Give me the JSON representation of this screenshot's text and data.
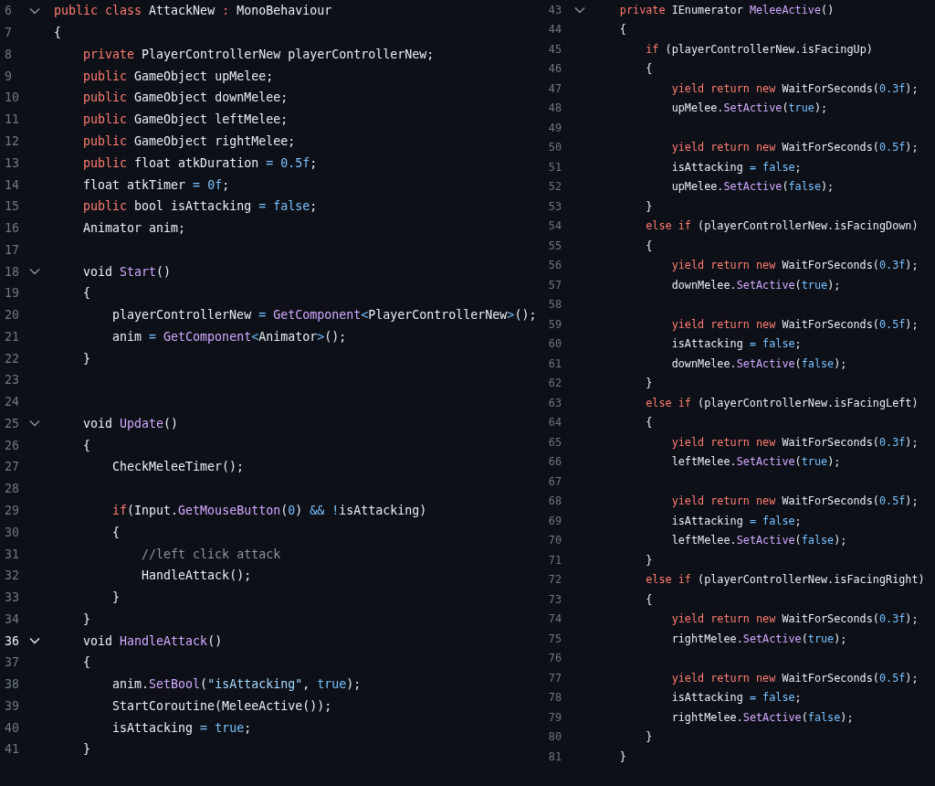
{
  "panes": [
    {
      "lines": [
        {
          "number": "6",
          "fold": true,
          "current": false,
          "tokens": [
            {
              "kind": "keyword",
              "text": "public class"
            },
            {
              "kind": "plain",
              "text": " AttackNew "
            },
            {
              "kind": "keyword",
              "text": ":"
            },
            {
              "kind": "plain",
              "text": " MonoBehaviour"
            }
          ]
        },
        {
          "number": "7",
          "fold": false,
          "current": false,
          "tokens": [
            {
              "kind": "plain",
              "text": "{"
            }
          ],
          "children": [
            {
              "number": "8",
              "fold": false,
              "current": false,
              "tokens": [
                {
                  "kind": "keyword",
                  "text": "private"
                },
                {
                  "kind": "plain",
                  "text": " PlayerControllerNew playerControllerNew;"
                }
              ]
            },
            {
              "number": "9",
              "fold": false,
              "current": false,
              "tokens": [
                {
                  "kind": "keyword",
                  "text": "public"
                },
                {
                  "kind": "plain",
                  "text": " GameObject upMelee;"
                }
              ]
            },
            {
              "number": "10",
              "fold": false,
              "current": false,
              "tokens": [
                {
                  "kind": "keyword",
                  "text": "public"
                },
                {
                  "kind": "plain",
                  "text": " GameObject downMelee;"
                }
              ]
            },
            {
              "number": "11",
              "fold": false,
              "current": false,
              "tokens": [
                {
                  "kind": "keyword",
                  "text": "public"
                },
                {
                  "kind": "plain",
                  "text": " GameObject leftMelee;"
                }
              ]
            },
            {
              "number": "12",
              "fold": false,
              "current": false,
              "tokens": [
                {
                  "kind": "keyword",
                  "text": "public"
                },
                {
                  "kind": "plain",
                  "text": " GameObject rightMelee;"
                }
              ]
            },
            {
              "number": "13",
              "fold": false,
              "current": false,
              "tokens": [
                {
                  "kind": "keyword",
                  "text": "public"
                },
                {
                  "kind": "plain",
                  "text": " float atkDuration "
                },
                {
                  "kind": "operator",
                  "text": "= "
                },
                {
                  "kind": "literal",
                  "text": "0.5f"
                },
                {
                  "kind": "plain",
                  "text": ";"
                }
              ]
            },
            {
              "number": "14",
              "fold": false,
              "current": false,
              "tokens": [
                {
                  "kind": "plain",
                  "text": "float atkTimer "
                },
                {
                  "kind": "operator",
                  "text": "= "
                },
                {
                  "kind": "literal",
                  "text": "0f"
                },
                {
                  "kind": "plain",
                  "text": ";"
                }
              ]
            },
            {
              "number": "15",
              "fold": false,
              "current": false,
              "tokens": [
                {
                  "kind": "keyword",
                  "text": "public"
                },
                {
                  "kind": "plain",
                  "text": " bool isAttacking "
                },
                {
                  "kind": "operator",
                  "text": "= "
                },
                {
                  "kind": "literal",
                  "text": "false"
                },
                {
                  "kind": "plain",
                  "text": ";"
                }
              ]
            },
            {
              "number": "16",
              "fold": false,
              "current": false,
              "tokens": [
                {
                  "kind": "plain",
                  "text": "Animator anim;"
                }
              ]
            },
            {
              "number": "17",
              "fold": false,
              "current": false
            },
            {
              "number": "18",
              "fold": true,
              "current": false,
              "tokens": [
                {
                  "kind": "plain",
                  "text": "void "
                },
                {
                  "kind": "function",
                  "text": "Start"
                },
                {
                  "kind": "plain",
                  "text": "()"
                }
              ]
            },
            {
              "number": "19",
              "fold": false,
              "current": false,
              "tokens": [
                {
                  "kind": "plain",
                  "text": "{"
                }
              ],
              "children": [
                {
                  "number": "20",
                  "fold": false,
                  "current": false,
                  "tokens": [
                    {
                      "kind": "plain",
                      "text": "playerControllerNew "
                    },
                    {
                      "kind": "operator",
                      "text": "= "
                    },
                    {
                      "kind": "function",
                      "text": "GetComponent"
                    },
                    {
                      "kind": "operator",
                      "text": "<"
                    },
                    {
                      "kind": "plain",
                      "text": "PlayerControllerNew"
                    },
                    {
                      "kind": "operator",
                      "text": ">"
                    },
                    {
                      "kind": "plain",
                      "text": "();"
                    }
                  ]
                },
                {
                  "number": "21",
                  "fold": false,
                  "current": false,
                  "tokens": [
                    {
                      "kind": "plain",
                      "text": "anim "
                    },
                    {
                      "kind": "operator",
                      "text": "= "
                    },
                    {
                      "kind": "function",
                      "text": "GetComponent"
                    },
                    {
                      "kind": "operator",
                      "text": "<"
                    },
                    {
                      "kind": "plain",
                      "text": "Animator"
                    },
                    {
                      "kind": "operator",
                      "text": ">"
                    },
                    {
                      "kind": "plain",
                      "text": "();"
                    }
                  ]
                }
              ]
            },
            {
              "number": "22",
              "fold": false,
              "current": false,
              "tokens": [
                {
                  "kind": "plain",
                  "text": "}"
                }
              ]
            },
            {
              "number": "23",
              "fold": false,
              "current": false
            },
            {
              "number": "24",
              "fold": false,
              "current": false
            },
            {
              "number": "25",
              "fold": true,
              "current": false,
              "tokens": [
                {
                  "kind": "plain",
                  "text": "void "
                },
                {
                  "kind": "function",
                  "text": "Update"
                },
                {
                  "kind": "plain",
                  "text": "()"
                }
              ]
            },
            {
              "number": "26",
              "fold": false,
              "current": false,
              "tokens": [
                {
                  "kind": "plain",
                  "text": "{"
                }
              ],
              "children": [
                {
                  "number": "27",
                  "fold": false,
                  "current": false,
                  "tokens": [
                    {
                      "kind": "plain",
                      "text": "CheckMeleeTimer();"
                    }
                  ]
                },
                {
                  "number": "28",
                  "fold": false,
                  "current": false
                },
                {
                  "number": "29",
                  "fold": false,
                  "current": false,
                  "tokens": [
                    {
                      "kind": "keyword",
                      "text": "if"
                    },
                    {
                      "kind": "plain",
                      "text": "(Input."
                    },
                    {
                      "kind": "function",
                      "text": "GetMouseButton"
                    },
                    {
                      "kind": "plain",
                      "text": "("
                    },
                    {
                      "kind": "literal",
                      "text": "0"
                    },
                    {
                      "kind": "plain",
                      "text": ") "
                    },
                    {
                      "kind": "operator",
                      "text": "&& !"
                    },
                    {
                      "kind": "plain",
                      "text": "isAttacking)"
                    }
                  ]
                },
                {
                  "number": "30",
                  "fold": false,
                  "current": false,
                  "tokens": [
                    {
                      "kind": "plain",
                      "text": "{"
                    }
                  ],
                  "children": [
                    {
                      "number": "31",
                      "fold": false,
                      "current": false,
                      "tokens": [
                        {
                          "kind": "comment",
                          "text": "//left click attack"
                        }
                      ]
                    },
                    {
                      "number": "32",
                      "fold": false,
                      "current": false,
                      "tokens": [
                        {
                          "kind": "plain",
                          "text": "HandleAttack();"
                        }
                      ]
                    }
                  ]
                },
                {
                  "number": "33",
                  "fold": false,
                  "current": false,
                  "tokens": [
                    {
                      "kind": "plain",
                      "text": "}"
                    }
                  ]
                }
              ]
            },
            {
              "number": "34",
              "fold": false,
              "current": false,
              "tokens": [
                {
                  "kind": "plain",
                  "text": "}"
                }
              ]
            },
            {
              "number": "36",
              "fold": true,
              "current": true,
              "tokens": [
                {
                  "kind": "plain",
                  "text": "void "
                },
                {
                  "kind": "function",
                  "text": "HandleAttack"
                },
                {
                  "kind": "plain",
                  "text": "()"
                }
              ]
            },
            {
              "number": "37",
              "fold": false,
              "current": false,
              "tokens": [
                {
                  "kind": "plain",
                  "text": "{"
                }
              ],
              "children": [
                {
                  "number": "38",
                  "fold": false,
                  "current": false,
                  "tokens": [
                    {
                      "kind": "plain",
                      "text": "anim."
                    },
                    {
                      "kind": "function",
                      "text": "SetBool"
                    },
                    {
                      "kind": "plain",
                      "text": "("
                    },
                    {
                      "kind": "string",
                      "text": "\"isAttacking\""
                    },
                    {
                      "kind": "plain",
                      "text": ", "
                    },
                    {
                      "kind": "literal",
                      "text": "true"
                    },
                    {
                      "kind": "plain",
                      "text": ");"
                    }
                  ]
                },
                {
                  "number": "39",
                  "fold": false,
                  "current": false,
                  "tokens": [
                    {
                      "kind": "plain",
                      "text": "StartCoroutine(MeleeActive());"
                    }
                  ]
                },
                {
                  "number": "40",
                  "fold": false,
                  "current": false,
                  "tokens": [
                    {
                      "kind": "plain",
                      "text": "isAttacking "
                    },
                    {
                      "kind": "operator",
                      "text": "= "
                    },
                    {
                      "kind": "literal",
                      "text": "true"
                    },
                    {
                      "kind": "plain",
                      "text": ";"
                    }
                  ]
                }
              ]
            },
            {
              "number": "41",
              "fold": false,
              "current": false,
              "tokens": [
                {
                  "kind": "plain",
                  "text": "}"
                }
              ]
            }
          ]
        }
      ]
    },
    {
      "lines": [
        {
          "number": "43",
          "fold": true,
          "current": false,
          "tokens": [
            {
              "kind": "keyword",
              "text": "private"
            },
            {
              "kind": "plain",
              "text": " IEnumerator "
            },
            {
              "kind": "function",
              "text": "MeleeActive"
            },
            {
              "kind": "plain",
              "text": "()"
            }
          ]
        },
        {
          "number": "44",
          "fold": false,
          "current": false,
          "tokens": [
            {
              "kind": "plain",
              "text": "{"
            }
          ],
          "children": [
            {
              "number": "45",
              "fold": false,
              "current": false,
              "tokens": [
                {
                  "kind": "keyword",
                  "text": "if"
                },
                {
                  "kind": "plain",
                  "text": " (playerControllerNew.isFacingUp)"
                }
              ]
            },
            {
              "number": "46",
              "fold": false,
              "current": false,
              "tokens": [
                {
                  "kind": "plain",
                  "text": "{"
                }
              ],
              "children": [
                {
                  "number": "47",
                  "fold": false,
                  "current": false,
                  "tokens": [
                    {
                      "kind": "keyword",
                      "text": "yield return new"
                    },
                    {
                      "kind": "plain",
                      "text": " WaitForSeconds("
                    },
                    {
                      "kind": "literal",
                      "text": "0.3f"
                    },
                    {
                      "kind": "plain",
                      "text": ");"
                    }
                  ]
                },
                {
                  "number": "48",
                  "fold": false,
                  "current": false,
                  "tokens": [
                    {
                      "kind": "plain",
                      "text": "upMelee."
                    },
                    {
                      "kind": "function",
                      "text": "SetActive"
                    },
                    {
                      "kind": "plain",
                      "text": "("
                    },
                    {
                      "kind": "literal",
                      "text": "true"
                    },
                    {
                      "kind": "plain",
                      "text": ");"
                    }
                  ]
                },
                {
                  "number": "49",
                  "fold": false,
                  "current": false
                },
                {
                  "number": "50",
                  "fold": false,
                  "current": false,
                  "tokens": [
                    {
                      "kind": "keyword",
                      "text": "yield return new"
                    },
                    {
                      "kind": "plain",
                      "text": " WaitForSeconds("
                    },
                    {
                      "kind": "literal",
                      "text": "0.5f"
                    },
                    {
                      "kind": "plain",
                      "text": ");"
                    }
                  ]
                },
                {
                  "number": "51",
                  "fold": false,
                  "current": false,
                  "tokens": [
                    {
                      "kind": "plain",
                      "text": "isAttacking "
                    },
                    {
                      "kind": "operator",
                      "text": "= "
                    },
                    {
                      "kind": "literal",
                      "text": "false"
                    },
                    {
                      "kind": "plain",
                      "text": ";"
                    }
                  ]
                },
                {
                  "number": "52",
                  "fold": false,
                  "current": false,
                  "tokens": [
                    {
                      "kind": "plain",
                      "text": "upMelee."
                    },
                    {
                      "kind": "function",
                      "text": "SetActive"
                    },
                    {
                      "kind": "plain",
                      "text": "("
                    },
                    {
                      "kind": "literal",
                      "text": "false"
                    },
                    {
                      "kind": "plain",
                      "text": ");"
                    }
                  ]
                }
              ]
            },
            {
              "number": "53",
              "fold": false,
              "current": false,
              "tokens": [
                {
                  "kind": "plain",
                  "text": "}"
                }
              ]
            },
            {
              "number": "54",
              "fold": false,
              "current": false,
              "tokens": [
                {
                  "kind": "keyword",
                  "text": "else if"
                },
                {
                  "kind": "plain",
                  "text": " (playerControllerNew.isFacingDown)"
                }
              ]
            },
            {
              "number": "55",
              "fold": false,
              "current": false,
              "tokens": [
                {
                  "kind": "plain",
                  "text": "{"
                }
              ],
              "children": [
                {
                  "number": "56",
                  "fold": false,
                  "current": false,
                  "tokens": [
                    {
                      "kind": "keyword",
                      "text": "yield return new"
                    },
                    {
                      "kind": "plain",
                      "text": " WaitForSeconds("
                    },
                    {
                      "kind": "literal",
                      "text": "0.3f"
                    },
                    {
                      "kind": "plain",
                      "text": ");"
                    }
                  ]
                },
                {
                  "number": "57",
                  "fold": false,
                  "current": false,
                  "tokens": [
                    {
                      "kind": "plain",
                      "text": "downMelee."
                    },
                    {
                      "kind": "function",
                      "text": "SetActive"
                    },
                    {
                      "kind": "plain",
                      "text": "("
                    },
                    {
                      "kind": "literal",
                      "text": "true"
                    },
                    {
                      "kind": "plain",
                      "text": ");"
                    }
                  ]
                },
                {
                  "number": "58",
                  "fold": false,
                  "current": false
                },
                {
                  "number": "59",
                  "fold": false,
                  "current": false,
                  "tokens": [
                    {
                      "kind": "keyword",
                      "text": "yield return new"
                    },
                    {
                      "kind": "plain",
                      "text": " WaitForSeconds("
                    },
                    {
                      "kind": "literal",
                      "text": "0.5f"
                    },
                    {
                      "kind": "plain",
                      "text": ");"
                    }
                  ]
                },
                {
                  "number": "60",
                  "fold": false,
                  "current": false,
                  "tokens": [
                    {
                      "kind": "plain",
                      "text": "isAttacking "
                    },
                    {
                      "kind": "operator",
                      "text": "= "
                    },
                    {
                      "kind": "literal",
                      "text": "false"
                    },
                    {
                      "kind": "plain",
                      "text": ";"
                    }
                  ]
                },
                {
                  "number": "61",
                  "fold": false,
                  "current": false,
                  "tokens": [
                    {
                      "kind": "plain",
                      "text": "downMelee."
                    },
                    {
                      "kind": "function",
                      "text": "SetActive"
                    },
                    {
                      "kind": "plain",
                      "text": "("
                    },
                    {
                      "kind": "literal",
                      "text": "false"
                    },
                    {
                      "kind": "plain",
                      "text": ");"
                    }
                  ]
                }
              ]
            },
            {
              "number": "62",
              "fold": false,
              "current": false,
              "tokens": [
                {
                  "kind": "plain",
                  "text": "}"
                }
              ]
            },
            {
              "number": "63",
              "fold": false,
              "current": false,
              "tokens": [
                {
                  "kind": "keyword",
                  "text": "else if"
                },
                {
                  "kind": "plain",
                  "text": " (playerControllerNew.isFacingLeft)"
                }
              ]
            },
            {
              "number": "64",
              "fold": false,
              "current": false,
              "tokens": [
                {
                  "kind": "plain",
                  "text": "{"
                }
              ],
              "children": [
                {
                  "number": "65",
                  "fold": false,
                  "current": false,
                  "tokens": [
                    {
                      "kind": "keyword",
                      "text": "yield return new"
                    },
                    {
                      "kind": "plain",
                      "text": " WaitForSeconds("
                    },
                    {
                      "kind": "literal",
                      "text": "0.3f"
                    },
                    {
                      "kind": "plain",
                      "text": ");"
                    }
                  ]
                },
                {
                  "number": "66",
                  "fold": false,
                  "current": false,
                  "tokens": [
                    {
                      "kind": "plain",
                      "text": "leftMelee."
                    },
                    {
                      "kind": "function",
                      "text": "SetActive"
                    },
                    {
                      "kind": "plain",
                      "text": "("
                    },
                    {
                      "kind": "literal",
                      "text": "true"
                    },
                    {
                      "kind": "plain",
                      "text": ");"
                    }
                  ]
                },
                {
                  "number": "67",
                  "fold": false,
                  "current": false
                },
                {
                  "number": "68",
                  "fold": false,
                  "current": false,
                  "tokens": [
                    {
                      "kind": "keyword",
                      "text": "yield return new"
                    },
                    {
                      "kind": "plain",
                      "text": " WaitForSeconds("
                    },
                    {
                      "kind": "literal",
                      "text": "0.5f"
                    },
                    {
                      "kind": "plain",
                      "text": ");"
                    }
                  ]
                },
                {
                  "number": "69",
                  "fold": false,
                  "current": false,
                  "tokens": [
                    {
                      "kind": "plain",
                      "text": "isAttacking "
                    },
                    {
                      "kind": "operator",
                      "text": "= "
                    },
                    {
                      "kind": "literal",
                      "text": "false"
                    },
                    {
                      "kind": "plain",
                      "text": ";"
                    }
                  ]
                },
                {
                  "number": "70",
                  "fold": false,
                  "current": false,
                  "tokens": [
                    {
                      "kind": "plain",
                      "text": "leftMelee."
                    },
                    {
                      "kind": "function",
                      "text": "SetActive"
                    },
                    {
                      "kind": "plain",
                      "text": "("
                    },
                    {
                      "kind": "literal",
                      "text": "false"
                    },
                    {
                      "kind": "plain",
                      "text": ");"
                    }
                  ]
                }
              ]
            },
            {
              "number": "71",
              "fold": false,
              "current": false,
              "tokens": [
                {
                  "kind": "plain",
                  "text": "}"
                }
              ]
            },
            {
              "number": "72",
              "fold": false,
              "current": false,
              "tokens": [
                {
                  "kind": "keyword",
                  "text": "else if"
                },
                {
                  "kind": "plain",
                  "text": " (playerControllerNew.isFacingRight)"
                }
              ]
            },
            {
              "number": "73",
              "fold": false,
              "current": false,
              "tokens": [
                {
                  "kind": "plain",
                  "text": "{"
                }
              ],
              "children": [
                {
                  "number": "74",
                  "fold": false,
                  "current": false,
                  "tokens": [
                    {
                      "kind": "keyword",
                      "text": "yield return new"
                    },
                    {
                      "kind": "plain",
                      "text": " WaitForSeconds("
                    },
                    {
                      "kind": "literal",
                      "text": "0.3f"
                    },
                    {
                      "kind": "plain",
                      "text": ");"
                    }
                  ]
                },
                {
                  "number": "75",
                  "fold": false,
                  "current": false,
                  "tokens": [
                    {
                      "kind": "plain",
                      "text": "rightMelee."
                    },
                    {
                      "kind": "function",
                      "text": "SetActive"
                    },
                    {
                      "kind": "plain",
                      "text": "("
                    },
                    {
                      "kind": "literal",
                      "text": "true"
                    },
                    {
                      "kind": "plain",
                      "text": ");"
                    }
                  ]
                },
                {
                  "number": "76",
                  "fold": false,
                  "current": false
                },
                {
                  "number": "77",
                  "fold": false,
                  "current": false,
                  "tokens": [
                    {
                      "kind": "keyword",
                      "text": "yield return new"
                    },
                    {
                      "kind": "plain",
                      "text": " WaitForSeconds("
                    },
                    {
                      "kind": "literal",
                      "text": "0.5f"
                    },
                    {
                      "kind": "plain",
                      "text": ");"
                    }
                  ]
                },
                {
                  "number": "78",
                  "fold": false,
                  "current": false,
                  "tokens": [
                    {
                      "kind": "plain",
                      "text": "isAttacking "
                    },
                    {
                      "kind": "operator",
                      "text": "= "
                    },
                    {
                      "kind": "literal",
                      "text": "false"
                    },
                    {
                      "kind": "plain",
                      "text": ";"
                    }
                  ]
                },
                {
                  "number": "79",
                  "fold": false,
                  "current": false,
                  "tokens": [
                    {
                      "kind": "plain",
                      "text": "rightMelee."
                    },
                    {
                      "kind": "function",
                      "text": "SetActive"
                    },
                    {
                      "kind": "plain",
                      "text": "("
                    },
                    {
                      "kind": "literal",
                      "text": "false"
                    },
                    {
                      "kind": "plain",
                      "text": ");"
                    }
                  ]
                }
              ]
            },
            {
              "number": "80",
              "fold": false,
              "current": false,
              "tokens": [
                {
                  "kind": "plain",
                  "text": "}"
                }
              ]
            }
          ]
        },
        {
          "number": "81",
          "fold": false,
          "current": false,
          "tokens": [
            {
              "kind": "plain",
              "text": "}"
            }
          ]
        }
      ]
    }
  ]
}
